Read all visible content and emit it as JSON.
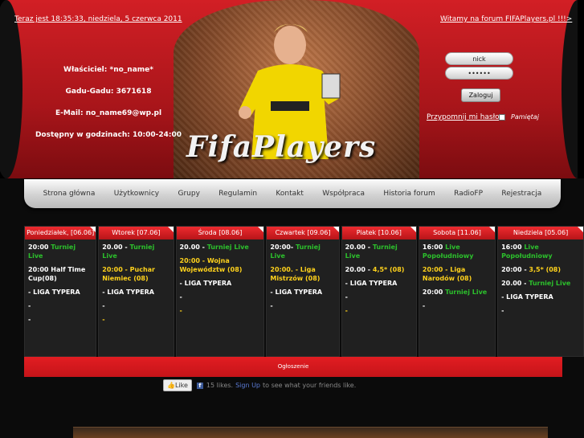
{
  "header": {
    "datetime": "Teraz jest 18:35:33, niedziela, 5 czerwca 2011",
    "welcome": "Witamy na forum FIFAPlayers.pl !!!>",
    "logo": "FifaPlayers",
    "owner": "Właściciel: *no_name*",
    "gg": "Gadu-Gadu: 3671618",
    "email": "E-Mail: no_name69@wp.pl",
    "hours": "Dostępny w godzinach: 10:00-24:00"
  },
  "login": {
    "user": "nick",
    "pass": "••••••",
    "button": "Zaloguj",
    "remind": "Przypomnij mi hasło",
    "remember": "Pamiętaj"
  },
  "nav": [
    "Strona główna",
    "Użytkownicy",
    "Grupy",
    "Regulamin",
    "Kontakt",
    "Współpraca",
    "Historia forum",
    "RadioFP",
    "Rejestracja"
  ],
  "schedule": [
    {
      "day": "Poniedziałek, [06.06]",
      "events": [
        [
          "20:00 ",
          "Turniej Live"
        ],
        [
          "20:00 Half Time Cup(08)",
          ""
        ],
        [
          "- LIGA TYPERA",
          ""
        ],
        [
          "-",
          ""
        ],
        [
          "-",
          ""
        ]
      ]
    },
    {
      "day": "Wtorek [07.06]",
      "events": [
        [
          "20.00 - ",
          "Turniej Live"
        ],
        [
          "20:00 - Puchar Niemiec (08)",
          ""
        ],
        [
          "- LIGA TYPERA",
          ""
        ],
        [
          "-",
          ""
        ],
        [
          "-",
          ""
        ]
      ]
    },
    {
      "day": "Środa [08.06]",
      "events": [
        [
          "20.00 - ",
          "Turniej Live"
        ],
        [
          "20:00 - Wojna Województw (08)",
          ""
        ],
        [
          "- LIGA TYPERA",
          ""
        ],
        [
          "-",
          ""
        ],
        [
          "-",
          ""
        ]
      ]
    },
    {
      "day": "Czwartek [09.06]",
      "events": [
        [
          "20:00- ",
          "Turniej Live"
        ],
        [
          "20:00. - Liga Mistrzów (08)",
          ""
        ],
        [
          "- LIGA TYPERA",
          ""
        ],
        [
          "-",
          ""
        ]
      ]
    },
    {
      "day": "Piatek [10.06]",
      "events": [
        [
          "20.00 - ",
          "Turniej Live"
        ],
        [
          "20.00 - ",
          "4,5* (08)"
        ],
        [
          "- LIGA TYPERA",
          ""
        ],
        [
          "-",
          ""
        ],
        [
          "-",
          ""
        ]
      ]
    },
    {
      "day": "Sobota [11.06]",
      "events": [
        [
          "16:00 ",
          "Live Popołudniowy"
        ],
        [
          "20:00 - Liga Narodów (08)",
          ""
        ],
        [
          "20:00 ",
          "Turniej Live"
        ],
        [
          "-",
          ""
        ]
      ]
    },
    {
      "day": "Niedziela [05.06]",
      "events": [
        [
          "16:00 ",
          "Live Popołudniowy"
        ],
        [
          "20:00 - ",
          "3,5* (08)"
        ],
        [
          "20.00 - ",
          "Turniej Live"
        ],
        [
          "- LIGA TYPERA",
          ""
        ],
        [
          "-",
          ""
        ]
      ]
    }
  ],
  "notice": "Ogłoszenie",
  "facebook": {
    "like": "Like",
    "likes": "15 likes.",
    "signup": "Sign Up",
    "rest": "to see what your friends like."
  }
}
